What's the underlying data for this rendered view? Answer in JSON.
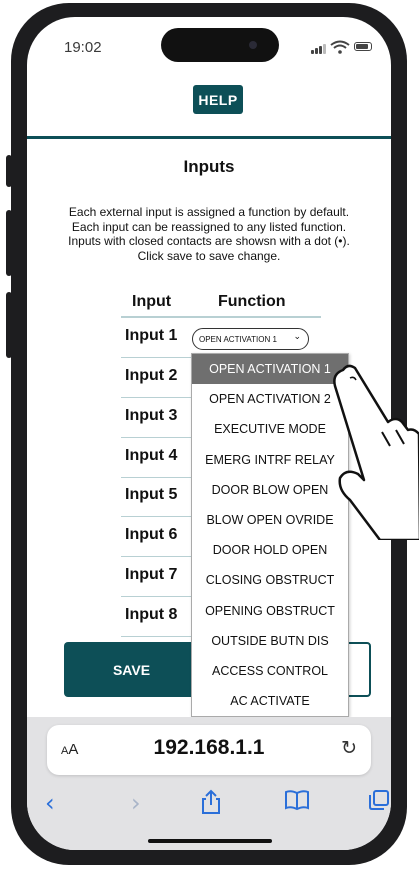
{
  "status_bar": {
    "time": "19:02"
  },
  "help_button": {
    "label": "HELP"
  },
  "page": {
    "title": "Inputs",
    "description": "Each external input is assigned a function by default. Each input can be reassigned to any listed function. Inputs with closed contacts are showsn with a dot (•). Click save to save change."
  },
  "table": {
    "headers": {
      "input": "Input",
      "function": "Function"
    },
    "rows": [
      {
        "input": "Input 1"
      },
      {
        "input": "Input 2"
      },
      {
        "input": "Input 3"
      },
      {
        "input": "Input 4"
      },
      {
        "input": "Input 5"
      },
      {
        "input": "Input 6"
      },
      {
        "input": "Input 7"
      },
      {
        "input": "Input 8"
      }
    ],
    "selected_function": "OPEN ACTIVATION 1"
  },
  "dropdown": {
    "options": [
      "OPEN ACTIVATION 1",
      "OPEN ACTIVATION 2",
      "EXECUTIVE MODE",
      "EMERG INTRF RELAY",
      "DOOR BLOW OPEN",
      "BLOW OPEN OVRIDE",
      "DOOR HOLD OPEN",
      "CLOSING OBSTRUCT",
      "OPENING OBSTRUCT",
      "OUTSIDE BUTN DIS",
      "ACCESS CONTROL",
      "AC ACTIVATE"
    ],
    "highlighted_index": 0
  },
  "buttons": {
    "save": "SAVE"
  },
  "browser": {
    "text_size_label_small": "A",
    "text_size_label_large": "A",
    "url": "192.168.1.1"
  },
  "icons": [
    "reload-icon",
    "back-icon",
    "forward-icon",
    "share-icon",
    "bookmarks-icon",
    "tabs-icon"
  ],
  "colors": {
    "brand_teal": "#0d4f57",
    "link_blue": "#2b6fd9",
    "selected_option_bg": "#6f6f6f"
  }
}
